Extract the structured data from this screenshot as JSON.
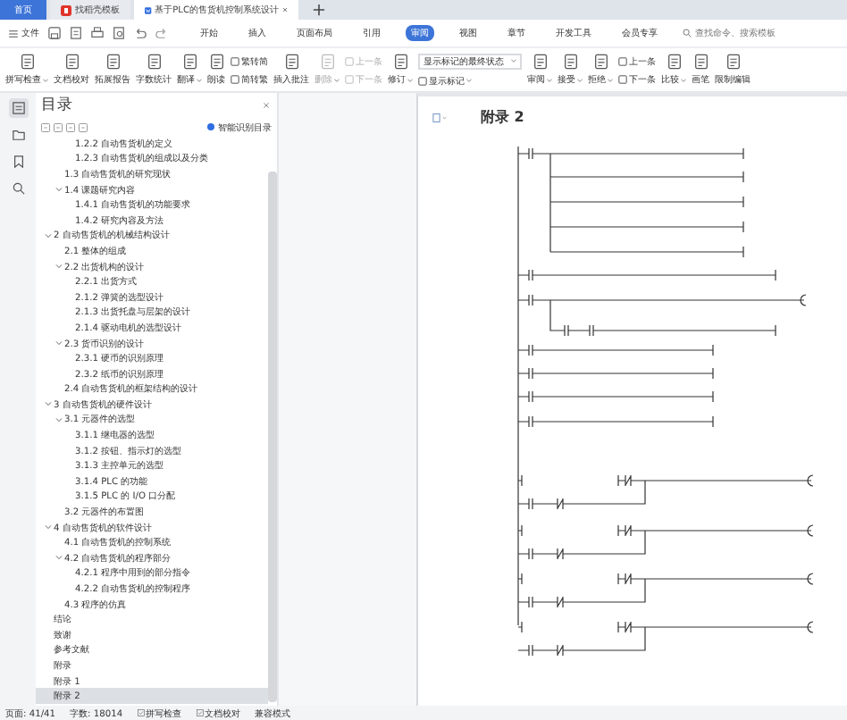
{
  "tabs": [
    {
      "label": "首页",
      "kind": "home",
      "selected": false
    },
    {
      "label": "找稻壳模板",
      "kind": "template",
      "selected": false
    },
    {
      "label": "基于PLC的售货机控制系统设计",
      "kind": "doc",
      "selected": true
    }
  ],
  "menu": {
    "file": "文件",
    "items": [
      {
        "label": "开始",
        "selected": false
      },
      {
        "label": "插入",
        "selected": false
      },
      {
        "label": "页面布局",
        "selected": false
      },
      {
        "label": "引用",
        "selected": false
      },
      {
        "label": "审阅",
        "selected": true
      },
      {
        "label": "视图",
        "selected": false
      },
      {
        "label": "章节",
        "selected": false
      },
      {
        "label": "开发工具",
        "selected": false
      },
      {
        "label": "会员专享",
        "selected": false
      }
    ],
    "search": {
      "placeholder": "查找命令、搜索模板"
    }
  },
  "toolbar": [
    {
      "kind": "large",
      "label": "拼写检查",
      "dropdown": true,
      "disabled": false
    },
    {
      "kind": "large",
      "label": "文档校对",
      "dropdown": false,
      "disabled": false
    },
    {
      "kind": "large",
      "label": "拓展报告",
      "dropdown": false,
      "disabled": false
    },
    {
      "kind": "large",
      "label": "字数统计",
      "dropdown": false,
      "disabled": false
    },
    {
      "kind": "large",
      "label": "翻译",
      "dropdown": true,
      "disabled": false
    },
    {
      "kind": "large",
      "label": "朗读",
      "dropdown": false,
      "disabled": false
    },
    {
      "kind": "stack",
      "items": [
        {
          "kind": "button",
          "label": "繁转简",
          "dropdown": false,
          "disabled": false
        },
        {
          "kind": "button",
          "label": "简转繁",
          "dropdown": false,
          "disabled": false
        }
      ]
    },
    {
      "kind": "large",
      "label": "插入批注",
      "dropdown": false,
      "disabled": false
    },
    {
      "kind": "large",
      "label": "删除",
      "dropdown": true,
      "disabled": true
    },
    {
      "kind": "stack",
      "items": [
        {
          "kind": "button",
          "label": "上一条",
          "dropdown": false,
          "disabled": true
        },
        {
          "kind": "button",
          "label": "下一条",
          "dropdown": false,
          "disabled": true
        }
      ]
    },
    {
      "kind": "large",
      "label": "修订",
      "dropdown": true,
      "disabled": false
    },
    {
      "kind": "stack",
      "items": [
        {
          "kind": "select",
          "value": "显示标记的最终状态"
        },
        {
          "kind": "button",
          "label": "显示标记",
          "dropdown": true,
          "disabled": false
        }
      ]
    },
    {
      "kind": "large",
      "label": "审阅",
      "dropdown": true,
      "disabled": false
    },
    {
      "kind": "large",
      "label": "接受",
      "dropdown": true,
      "disabled": false
    },
    {
      "kind": "large",
      "label": "拒绝",
      "dropdown": true,
      "disabled": false
    },
    {
      "kind": "stack",
      "items": [
        {
          "kind": "button",
          "label": "上一条",
          "dropdown": false,
          "disabled": false
        },
        {
          "kind": "button",
          "label": "下一条",
          "dropdown": false,
          "disabled": false
        }
      ]
    },
    {
      "kind": "large",
      "label": "比较",
      "dropdown": true,
      "disabled": false
    },
    {
      "kind": "large",
      "label": "画笔",
      "dropdown": false,
      "disabled": false
    },
    {
      "kind": "large",
      "label": "限制编辑",
      "dropdown": false,
      "disabled": false
    }
  ],
  "nav_rail": [
    {
      "selected": true
    },
    {
      "selected": false
    },
    {
      "selected": false
    },
    {
      "selected": false
    }
  ],
  "toc_panel": {
    "title": "目录",
    "smart_toc": {
      "label": "智能识别目录",
      "checked": true
    },
    "items": [
      {
        "children": [
          {
            "children": [
              {
                "label": "1.2.2 自动售货机的定义",
                "selected": false
              },
              {
                "label": "1.2.3 自动售货机的组成以及分类",
                "selected": false
              }
            ]
          },
          {
            "label": "1.3 自动售货机的研究现状",
            "selected": false
          },
          {
            "label": "1.4 课题研究内容",
            "expanded": true,
            "selected": false,
            "children": [
              {
                "label": "1.4.1 自动售货机的功能要求",
                "selected": false
              },
              {
                "label": "1.4.2 研究内容及方法",
                "selected": false
              }
            ]
          }
        ]
      },
      {
        "label": "2 自动售货机的机械结构设计",
        "expanded": true,
        "selected": false,
        "children": [
          {
            "label": "2.1 整体的组成",
            "selected": false
          },
          {
            "label": "2.2 出货机构的设计",
            "expanded": true,
            "selected": false,
            "children": [
              {
                "label": "2.2.1 出货方式",
                "selected": false
              },
              {
                "label": "2.1.2 弹簧的选型设计",
                "selected": false
              },
              {
                "label": "2.1.3 出货托盘与层架的设计",
                "selected": false
              },
              {
                "label": "2.1.4 驱动电机的选型设计",
                "selected": false
              }
            ]
          },
          {
            "label": "2.3 货币识别的设计",
            "expanded": true,
            "selected": false,
            "children": [
              {
                "label": "2.3.1 硬币的识别原理",
                "selected": false
              },
              {
                "label": "2.3.2 纸币的识别原理",
                "selected": false
              }
            ]
          },
          {
            "label": "2.4 自动售货机的框架结构的设计",
            "selected": false
          }
        ]
      },
      {
        "label": "3 自动售货机的硬件设计",
        "expanded": true,
        "selected": false,
        "children": [
          {
            "label": "3.1 元器件的选型",
            "expanded": true,
            "selected": false,
            "children": [
              {
                "label": "3.1.1 继电器的选型",
                "selected": false
              },
              {
                "label": "3.1.2 按钮、指示灯的选型",
                "selected": false
              },
              {
                "label": "3.1.3 主控单元的选型",
                "selected": false
              },
              {
                "label": "3.1.4 PLC 的功能",
                "selected": false
              },
              {
                "label": "3.1.5 PLC 的 I/O 口分配",
                "selected": false
              }
            ]
          },
          {
            "label": "3.2 元器件的布置图",
            "selected": false
          }
        ]
      },
      {
        "label": "4 自动售货机的软件设计",
        "expanded": true,
        "selected": false,
        "children": [
          {
            "label": "4.1 自动售货机的控制系统",
            "selected": false
          },
          {
            "label": "4.2 自动售货机的程序部分",
            "expanded": true,
            "selected": false,
            "children": [
              {
                "label": "4.2.1 程序中用到的部分指令",
                "selected": false
              },
              {
                "label": "4.2.2 自动售货机的控制程序",
                "selected": false
              }
            ]
          },
          {
            "label": "4.3 程序的仿真",
            "selected": false
          }
        ]
      },
      {
        "label": "结论",
        "selected": false
      },
      {
        "label": "致谢",
        "selected": false
      },
      {
        "label": "参考文献",
        "selected": false
      },
      {
        "label": "附录",
        "selected": false
      },
      {
        "label": "附录 1",
        "selected": false
      },
      {
        "label": "附录 2",
        "selected": true
      }
    ]
  },
  "document": {
    "heading": "附录 2"
  },
  "status_bar": [
    {
      "kind": "text",
      "label": "页面: 41/41"
    },
    {
      "kind": "text",
      "label": "字数: 18014"
    },
    {
      "kind": "icon",
      "label": "拼写检查"
    },
    {
      "kind": "icon",
      "label": "文档校对"
    },
    {
      "kind": "text",
      "label": "兼容模式"
    }
  ]
}
